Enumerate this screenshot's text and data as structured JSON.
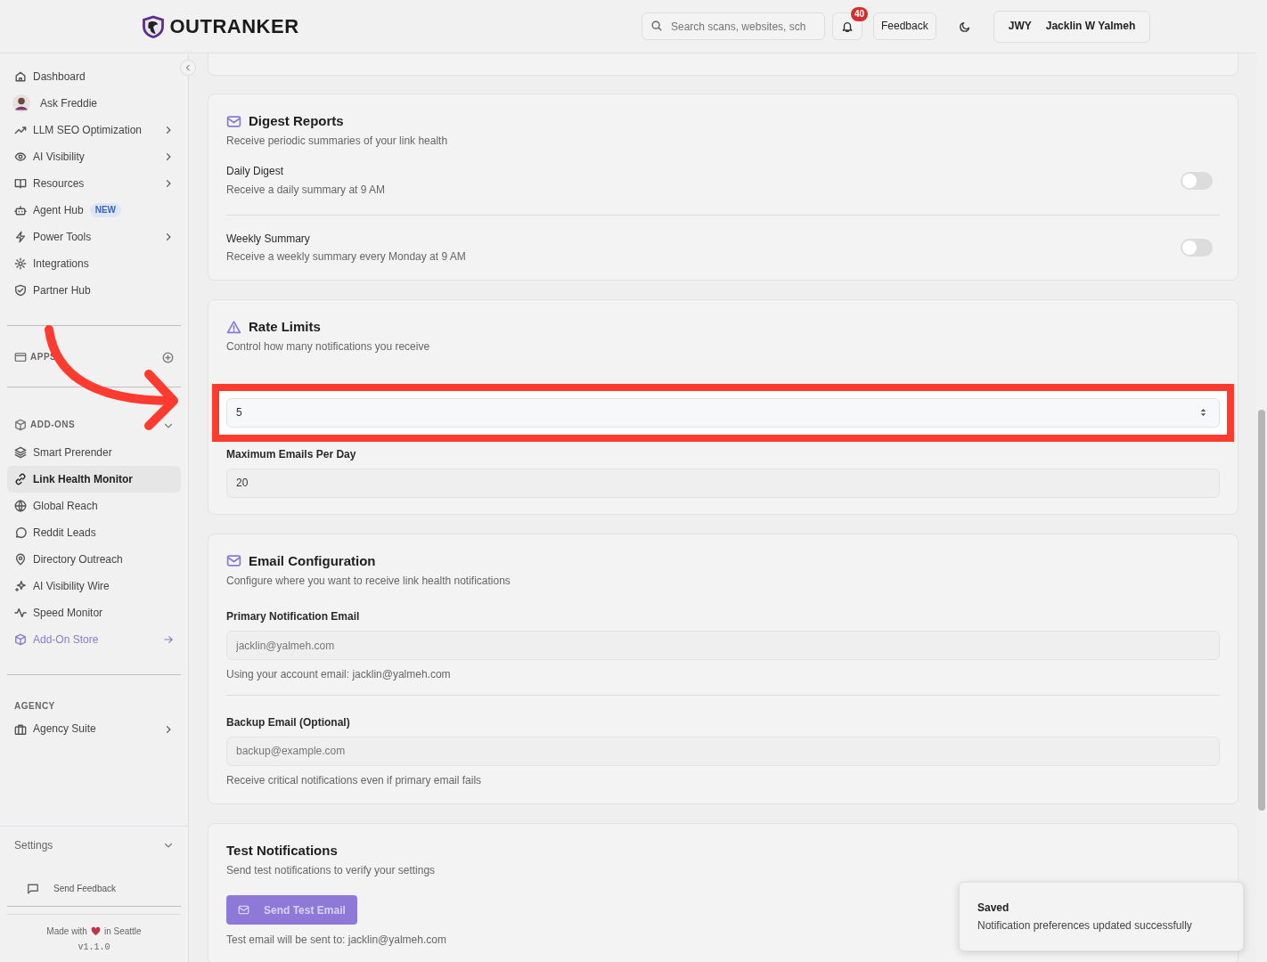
{
  "header": {
    "logo_text": "OUTRANKER",
    "search": {
      "placeholder": "Search scans, websites, sch"
    },
    "notifications": "40",
    "feedback": "Feedback",
    "user": {
      "initials": "JWY",
      "name": "Jacklin W Yalmeh"
    }
  },
  "sidebar": {
    "main_items": [
      {
        "label": "Dashboard",
        "kind": "plain",
        "chevron": false,
        "selected": false
      },
      {
        "label": "Ask Freddie",
        "kind": "avatar",
        "chevron": false,
        "selected": false
      },
      {
        "label": "LLM SEO Optimization",
        "kind": "plain",
        "chevron": true,
        "selected": false
      },
      {
        "label": "AI Visibility",
        "kind": "plain",
        "chevron": true,
        "selected": false
      },
      {
        "label": "Resources",
        "kind": "plain",
        "chevron": true,
        "selected": false
      },
      {
        "label": "Agent Hub",
        "kind": "plain",
        "chevron": false,
        "selected": false,
        "badge": "NEW"
      },
      {
        "label": "Power Tools",
        "kind": "plain",
        "chevron": true,
        "selected": false
      },
      {
        "label": "Integrations",
        "kind": "plain",
        "chevron": false,
        "selected": false
      },
      {
        "label": "Partner Hub",
        "kind": "plain",
        "chevron": false,
        "selected": false
      }
    ],
    "apps": {
      "title": "APPS"
    },
    "addons": {
      "title": "ADD-ONS",
      "expanded": true,
      "items": [
        {
          "label": "Smart Prerender",
          "kind": "plain",
          "selected": false
        },
        {
          "label": "Link Health Monitor",
          "kind": "plain",
          "selected": true
        },
        {
          "label": "Global Reach",
          "kind": "plain",
          "selected": false
        },
        {
          "label": "Reddit Leads",
          "kind": "plain",
          "selected": false
        },
        {
          "label": "Directory Outreach",
          "kind": "plain",
          "selected": false
        },
        {
          "label": "AI Visibility Wire",
          "kind": "plain",
          "selected": false
        },
        {
          "label": "Speed Monitor",
          "kind": "plain",
          "selected": false
        },
        {
          "label": "Add-On Store",
          "kind": "store",
          "selected": false
        }
      ]
    },
    "agency": {
      "title": "AGENCY",
      "items": [
        {
          "label": "Agency Suite",
          "chevron": true
        }
      ]
    },
    "settings": {
      "label": "Settings",
      "expanded": false
    },
    "send_feedback": "Send Feedback",
    "footer": {
      "made_with": "Made with",
      "in_city": "in Seattle",
      "version": "v1.1.0"
    }
  },
  "cards": [
    {
      "kind": "toggles",
      "title": "Digest Reports",
      "subtitle": "Receive periodic summaries of your link health",
      "rows": [
        {
          "label": "Daily Digest",
          "description": "Receive a daily summary at 9 AM",
          "on": false
        },
        {
          "label": "Weekly Summary",
          "description": "Receive a weekly summary every Monday at 9 AM",
          "on": false
        }
      ]
    },
    {
      "kind": "rate",
      "title": "Rate Limits",
      "subtitle": "Control how many notifications you receive",
      "fields": [
        {
          "value": "5",
          "highlighted": true
        },
        {
          "label": "Maximum Emails Per Day",
          "value": "20",
          "highlighted": false
        }
      ]
    },
    {
      "kind": "email",
      "title": "Email Configuration",
      "subtitle": "Configure where you want to receive link health notifications",
      "fields": [
        {
          "label": "Primary Notification Email",
          "placeholder": "jacklin@yalmeh.com",
          "hint": "Using your account email: jacklin@yalmeh.com"
        },
        {
          "label": "Backup Email (Optional)",
          "placeholder": "backup@example.com",
          "hint": "Receive critical notifications even if primary email fails"
        }
      ]
    },
    {
      "kind": "test",
      "title": "Test Notifications",
      "subtitle": "Send test notifications to verify your settings",
      "button": {
        "label": "Send Test Email",
        "disabled": true
      },
      "note": "Test email will be sent to: jacklin@yalmeh.com"
    }
  ],
  "toast": {
    "title": "Saved",
    "message": "Notification preferences updated successfully"
  }
}
